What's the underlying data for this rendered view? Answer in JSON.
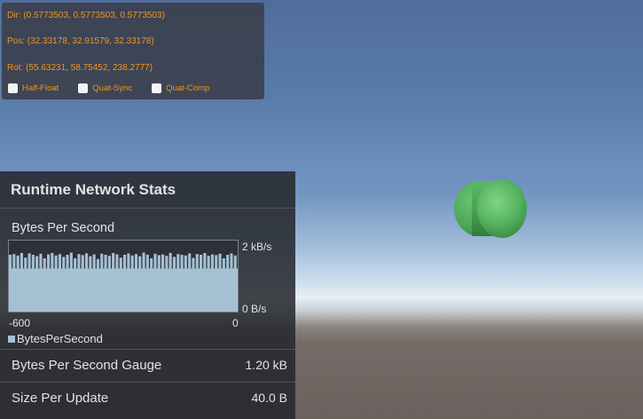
{
  "debug": {
    "dir": "Dir: (0.5773503, 0.5773503, 0.5773503)",
    "pos": "Pos: (32.33178, 32.91579, 32.33178)",
    "rot": "Rot: (55.63231, 58.75452, 238.2777)",
    "toggles": [
      {
        "label": "Half-Float",
        "checked": false
      },
      {
        "label": "Quat-Sync",
        "checked": false
      },
      {
        "label": "Quat-Comp",
        "checked": false
      }
    ],
    "text_color": "#f0951c"
  },
  "stats": {
    "title": "Runtime Network Stats",
    "graph": {
      "title": "Bytes Per Second",
      "y_max_label": "2 kB/s",
      "y_min_label": "0 B/s",
      "x_min_label": "-600",
      "x_max_label": "0",
      "legend": "BytesPerSecond",
      "series_color": "#a5c1d4"
    },
    "rows": [
      {
        "label": "Bytes Per Second Gauge",
        "value": "1.20 kB"
      },
      {
        "label": "Size Per Update",
        "value": "40.0 B"
      }
    ]
  },
  "chart_data": {
    "type": "area",
    "series": [
      {
        "name": "BytesPerSecond",
        "values": [
          1600,
          1620,
          1580,
          1650,
          1520,
          1640,
          1600,
          1560,
          1630,
          1500,
          1610,
          1650,
          1580,
          1620,
          1540,
          1600,
          1660,
          1500,
          1620,
          1590,
          1640,
          1560,
          1610,
          1480,
          1630,
          1600,
          1570,
          1650,
          1610,
          1520,
          1600,
          1640,
          1580,
          1620,
          1560,
          1660,
          1600,
          1500,
          1630,
          1590,
          1610,
          1570,
          1650,
          1540,
          1620,
          1600,
          1580,
          1640,
          1510,
          1620,
          1600,
          1650,
          1570,
          1610,
          1590,
          1630,
          1500,
          1600,
          1640,
          1580
        ]
      }
    ],
    "xlim": [
      -600,
      0
    ],
    "ylim": [
      0,
      2000
    ],
    "ylabel_ticks": [
      "2 kB/s",
      "0 B/s"
    ],
    "xlabel_ticks": [
      "-600",
      "0"
    ]
  }
}
